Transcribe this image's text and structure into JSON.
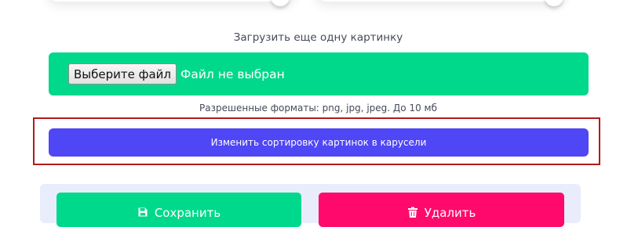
{
  "upload": {
    "title": "Загрузить еще одну картинку",
    "choose_file_label": "Выберите файл",
    "no_file_text": "Файл не выбран",
    "formats_note": "Разрешенные форматы: png, jpg, jpeg. До 10 мб"
  },
  "sort_button_label": "Изменить сортировку картинок в карусели",
  "actions": {
    "save_label": "Сохранить",
    "save_icon": "floppy-disk-icon",
    "delete_label": "Удалить",
    "delete_icon": "trash-icon"
  },
  "colors": {
    "upload_zone": "#00d98b",
    "sort_button": "#4f46f5",
    "highlight_frame": "#b11b1b",
    "save_button": "#00d98b",
    "delete_button": "#ff0a6c",
    "actions_panel": "#e9ecfb"
  }
}
